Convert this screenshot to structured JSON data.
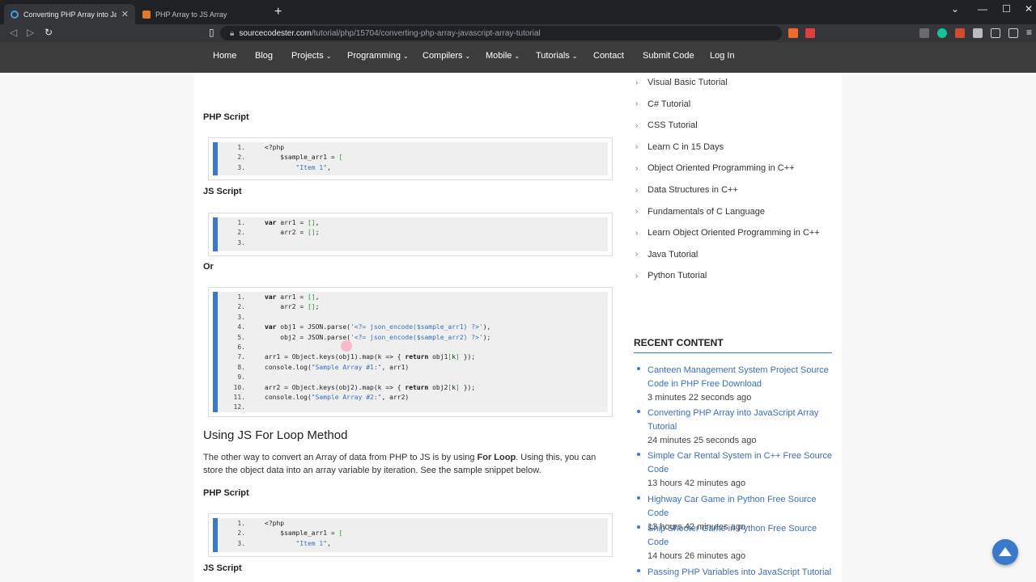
{
  "browser": {
    "tabs": [
      {
        "title": "Converting PHP Array into JavaSc",
        "active": true
      },
      {
        "title": "PHP Array to JS Array",
        "active": false
      }
    ],
    "url_host": "sourcecodester.com",
    "url_path": "/tutorial/php/15704/converting-php-array-javascript-array-tutorial"
  },
  "nav": {
    "items": [
      "Home",
      "Blog",
      "Projects",
      "Programming",
      "Compilers",
      "Mobile",
      "Tutorials",
      "Contact",
      "Submit Code",
      "Log In"
    ]
  },
  "main": {
    "php_script_1": "PHP Script",
    "code1": [
      {
        "n": "1.",
        "t": "<?php"
      },
      {
        "n": "2.",
        "t": "    $sample_arr1 = ["
      },
      {
        "n": "3.",
        "t": "        \"Item 1\","
      }
    ],
    "js_script_1": "JS Script",
    "code2": [
      {
        "n": "1.",
        "t": "var arr1 = [],"
      },
      {
        "n": "2.",
        "t": "    arr2 = [];"
      },
      {
        "n": "3.",
        "t": ""
      }
    ],
    "or_label": "Or",
    "code3": [
      {
        "n": "1.",
        "t": "var arr1 = [],"
      },
      {
        "n": "2.",
        "t": "    arr2 = [];"
      },
      {
        "n": "3.",
        "t": ""
      },
      {
        "n": "4.",
        "t": "var obj1 = JSON.parse('<?= json_encode($sample_arr1) ?>'),"
      },
      {
        "n": "5.",
        "t": "    obj2 = JSON.parse('<?= json_encode($sample_arr2) ?>');"
      },
      {
        "n": "6.",
        "t": ""
      },
      {
        "n": "7.",
        "t": "arr1 = Object.keys(obj1).map(k => { return obj1[k] });"
      },
      {
        "n": "8.",
        "t": "console.log(\"Sample Array #1:\", arr1)"
      },
      {
        "n": "9.",
        "t": ""
      },
      {
        "n": "10.",
        "t": "arr2 = Object.keys(obj2).map(k => { return obj2[k] });"
      },
      {
        "n": "11.",
        "t": "console.log(\"Sample Array #2:\", arr2)"
      },
      {
        "n": "12.",
        "t": ""
      }
    ],
    "section_title": "Using JS For Loop Method",
    "para_before": "The other way to convert an Array of data from PHP to JS is by using ",
    "para_bold": "For Loop",
    "para_after": ". Using this, you can store the object data into an array variable by iteration. See the sample snippet below.",
    "php_script_2": "PHP Script",
    "code4": [
      {
        "n": "1.",
        "t": "<?php"
      },
      {
        "n": "2.",
        "t": "    $sample_arr1 = ["
      },
      {
        "n": "3.",
        "t": "        \"Item 1\","
      }
    ],
    "js_script_2": "JS Script"
  },
  "sidebar": {
    "tutorials": [
      "Visual Basic Tutorial",
      "C# Tutorial",
      "CSS Tutorial",
      "Learn C in 15 Days",
      "Object Oriented Programming in C++",
      "Data Structures in C++",
      "Fundamentals of C Language",
      "Learn Object Oriented Programming in C++",
      "Java Tutorial",
      "Python Tutorial"
    ],
    "recent_title": "RECENT CONTENT",
    "recent": [
      {
        "title": "Canteen Management System Project Source Code in PHP Free Download",
        "time": "3 minutes 22 seconds ago"
      },
      {
        "title": "Converting PHP Array into JavaScript Array Tutorial",
        "time": "24 minutes 25 seconds ago"
      },
      {
        "title": "Simple Car Rental System in C++ Free Source Code",
        "time": "13 hours 42 minutes ago"
      },
      {
        "title": "Highway Car Game in Python Free Source Code",
        "time": "13 hours 42 minutes ago"
      },
      {
        "title": "Ship Shooter Game in Python Free Source Code",
        "time": "14 hours 26 minutes ago"
      },
      {
        "title": "Passing PHP Variables into JavaScript Tutorial",
        "time": ""
      }
    ]
  }
}
